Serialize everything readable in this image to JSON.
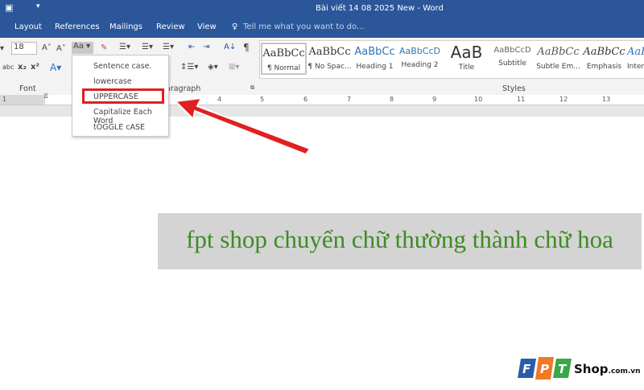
{
  "window": {
    "title": "Bài viết 14 08 2025 New - Word",
    "qat_icon": "customize-qat-icon"
  },
  "tabs": [
    "Layout",
    "References",
    "Mailings",
    "Review",
    "View"
  ],
  "tell_me": "Tell me what you want to do...",
  "font": {
    "size": "18",
    "group_label": "Font",
    "change_case_label": "Aa"
  },
  "paragraph": {
    "group_label": "aragraph"
  },
  "styles": {
    "group_label": "Styles",
    "items": [
      {
        "preview": "AaBbCc",
        "name": "¶ Normal"
      },
      {
        "preview": "AaBbCc",
        "name": "¶ No Spac..."
      },
      {
        "preview": "AaBbCc",
        "name": "Heading 1"
      },
      {
        "preview": "AaBbCcD",
        "name": "Heading 2"
      },
      {
        "preview": "AaB",
        "name": "Title"
      },
      {
        "preview": "AaBbCcD",
        "name": "Subtitle"
      },
      {
        "preview": "AaBbCc",
        "name": "Subtle Em..."
      },
      {
        "preview": "AaBbCc",
        "name": "Emphasis"
      },
      {
        "preview": "AaBb",
        "name": "Inten"
      }
    ]
  },
  "ruler": [
    "1",
    "4",
    "5",
    "6",
    "7",
    "8",
    "9",
    "10",
    "11",
    "12",
    "13"
  ],
  "change_case_menu": [
    "Sentence case.",
    "lowercase",
    "UPPERCASE",
    "Capitalize Each Word",
    "tOGGLE cASE"
  ],
  "document": {
    "text": "fpt shop chuyển chữ thường thành chữ hoa"
  },
  "logo": {
    "text": "FPT Shop.com.vn"
  },
  "colors": {
    "title_bar": "#2b579a",
    "highlight": "#e02020",
    "doc_text": "#3d8b24"
  }
}
